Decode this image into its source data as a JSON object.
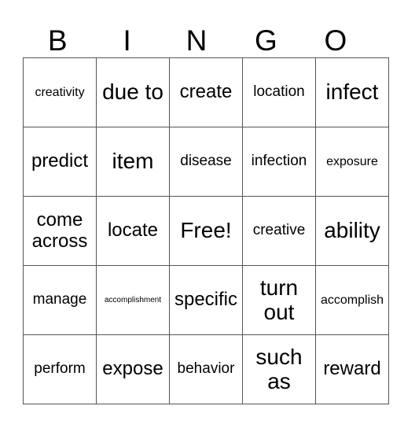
{
  "header": [
    "B",
    "I",
    "N",
    "G",
    "O"
  ],
  "rows": [
    [
      {
        "text": "creativity",
        "size": "sm"
      },
      {
        "text": "due to",
        "size": "xl"
      },
      {
        "text": "create",
        "size": "lg"
      },
      {
        "text": "location",
        "size": "md"
      },
      {
        "text": "infect",
        "size": "xl"
      }
    ],
    [
      {
        "text": "predict",
        "size": "lg"
      },
      {
        "text": "item",
        "size": "xl"
      },
      {
        "text": "disease",
        "size": "md"
      },
      {
        "text": "infection",
        "size": "md"
      },
      {
        "text": "exposure",
        "size": "sm"
      }
    ],
    [
      {
        "text": "come across",
        "size": "lg"
      },
      {
        "text": "locate",
        "size": "lg"
      },
      {
        "text": "Free!",
        "size": "xl"
      },
      {
        "text": "creative",
        "size": "md"
      },
      {
        "text": "ability",
        "size": "xl"
      }
    ],
    [
      {
        "text": "manage",
        "size": "md"
      },
      {
        "text": "accomplishment",
        "size": "xs"
      },
      {
        "text": "specific",
        "size": "lg"
      },
      {
        "text": "turn out",
        "size": "xl"
      },
      {
        "text": "accomplish",
        "size": "sm"
      }
    ],
    [
      {
        "text": "perform",
        "size": "md"
      },
      {
        "text": "expose",
        "size": "lg"
      },
      {
        "text": "behavior",
        "size": "md"
      },
      {
        "text": "such as",
        "size": "xl"
      },
      {
        "text": "reward",
        "size": "lg"
      }
    ]
  ]
}
